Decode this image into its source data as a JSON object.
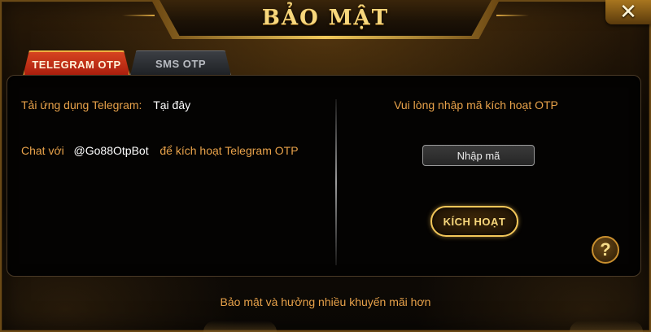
{
  "dialog": {
    "title": "BẢO MẬT",
    "close_icon": "close-x-icon"
  },
  "tabs": [
    {
      "label": "TELEGRAM OTP",
      "active": true
    },
    {
      "label": "SMS OTP",
      "active": false
    }
  ],
  "left": {
    "download_label": "Tải ứng dụng Telegram:",
    "download_link": "Tại đây",
    "chat_prefix": "Chat với",
    "bot_name": "@Go88OtpBot",
    "chat_suffix": "để kích hoạt Telegram OTP"
  },
  "right": {
    "prompt": "Vui lòng nhập mã kích hoạt OTP",
    "code_placeholder": "Nhập mã",
    "activate_label": "KÍCH HOẠT",
    "help_label": "?"
  },
  "footer": {
    "text": "Bảo mật và hưởng nhiều khuyến mãi hơn"
  },
  "colors": {
    "accent_gold": "#f7d77c",
    "text_orange": "#e8a24a",
    "tab_active_red": "#c32e14"
  }
}
